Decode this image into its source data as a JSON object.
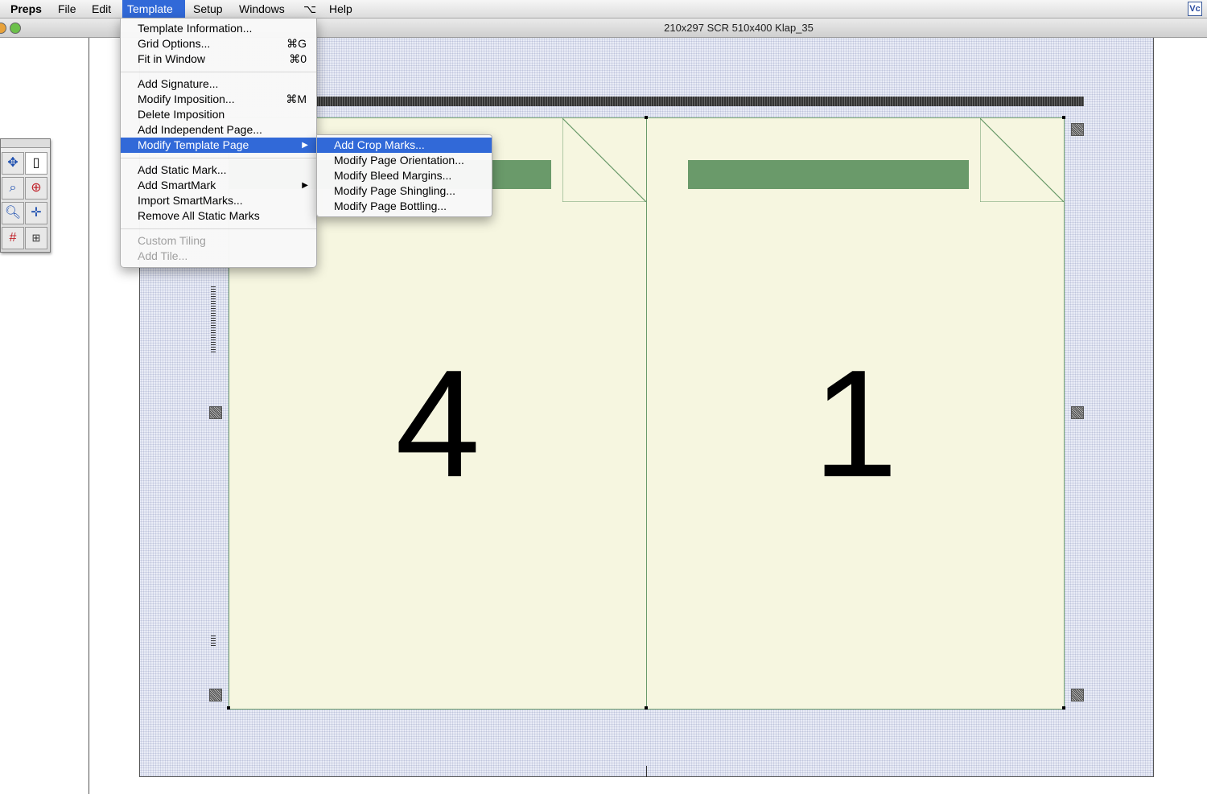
{
  "menubar": {
    "items": [
      {
        "label": "Preps"
      },
      {
        "label": "File"
      },
      {
        "label": "Edit"
      },
      {
        "label": "Template"
      },
      {
        "label": "Setup"
      },
      {
        "label": "Windows"
      },
      {
        "label": "⌥"
      },
      {
        "label": "Help"
      }
    ],
    "active": "Template",
    "version_icon": "Vc"
  },
  "window": {
    "title": "210x297 SCR 510x400 Klap_35"
  },
  "template_menu": {
    "items": [
      {
        "label": "Template Information...",
        "shortcut": ""
      },
      {
        "label": "Grid Options...",
        "shortcut": "⌘G"
      },
      {
        "label": "Fit in Window",
        "shortcut": "⌘0"
      },
      {
        "label": "Add Signature...",
        "shortcut": ""
      },
      {
        "label": "Modify Imposition...",
        "shortcut": "⌘M"
      },
      {
        "label": "Delete Imposition",
        "shortcut": ""
      },
      {
        "label": "Add Independent Page...",
        "shortcut": ""
      },
      {
        "label": "Modify Template Page",
        "shortcut": "",
        "submenu": true,
        "highlighted": true
      },
      {
        "label": "Add Static Mark...",
        "shortcut": ""
      },
      {
        "label": "Add SmartMark",
        "shortcut": "",
        "submenu": true
      },
      {
        "label": "Import SmartMarks...",
        "shortcut": ""
      },
      {
        "label": "Remove All Static Marks",
        "shortcut": ""
      },
      {
        "label": "Custom Tiling",
        "shortcut": "",
        "disabled": true
      },
      {
        "label": "Add Tile...",
        "shortcut": "",
        "disabled": true
      }
    ]
  },
  "submenu": {
    "items": [
      {
        "label": "Add Crop Marks...",
        "highlighted": true
      },
      {
        "label": "Modify Page Orientation..."
      },
      {
        "label": "Modify Bleed Margins..."
      },
      {
        "label": "Modify Page Shingling..."
      },
      {
        "label": "Modify Page Bottling..."
      }
    ]
  },
  "pages": [
    {
      "number": "4"
    },
    {
      "number": "1"
    }
  ],
  "palette": {
    "tools": [
      "move-tool-icon",
      "page-tool-icon",
      "zoom-tool-icon",
      "target-tool-icon",
      "magnify-tool-icon",
      "crop-tool-icon",
      "grid-tool-icon",
      "marks-tool-icon"
    ]
  },
  "colors": {
    "highlight": "#3169d8",
    "page_fill": "#f6f6e0",
    "page_bar": "#6a9a6a",
    "sheet_bg": "#e9ecf6"
  }
}
